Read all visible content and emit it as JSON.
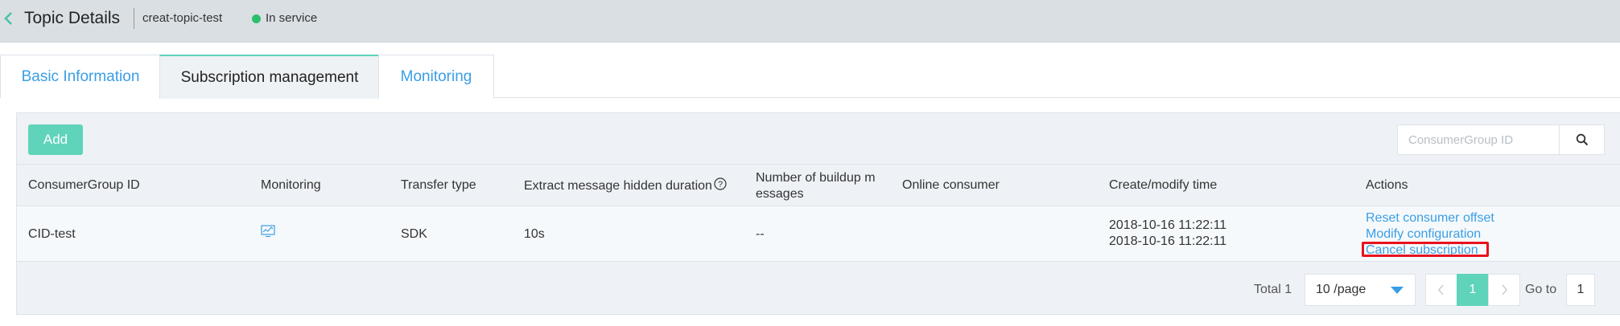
{
  "header": {
    "title": "Topic Details",
    "topic_name": "creat-topic-test",
    "status": "In service",
    "status_color": "#2cbf6e"
  },
  "tabs": [
    {
      "label": "Basic Information"
    },
    {
      "label": "Subscription management"
    },
    {
      "label": "Monitoring"
    }
  ],
  "toolbar": {
    "add_label": "Add",
    "search_placeholder": "ConsumerGroup ID"
  },
  "table": {
    "columns": {
      "group_id": "ConsumerGroup ID",
      "monitoring": "Monitoring",
      "transfer_type": "Transfer type",
      "hidden_duration": "Extract message hidden duration",
      "buildup_line1": "Number of buildup m",
      "buildup_line2": "essages",
      "online_consumer": "Online consumer",
      "time": "Create/modify time",
      "actions": "Actions"
    },
    "rows": [
      {
        "group_id": "CID-test",
        "monitoring_icon": "monitor-chart-icon",
        "transfer_type": "SDK",
        "hidden_duration": "10s",
        "buildup": "--",
        "online_consumer": "",
        "create_time": "2018-10-16 11:22:11",
        "modify_time": "2018-10-16 11:22:11",
        "actions": {
          "reset": "Reset consumer offset",
          "modify": "Modify configuration",
          "cancel": "Cancel subscription"
        }
      }
    ]
  },
  "pagination": {
    "total": "Total 1",
    "page_size": "10 /page",
    "current_page": "1",
    "goto_label": "Go to",
    "goto_value": "1"
  },
  "colors": {
    "accent": "#5fd4ba",
    "link": "#3a9ee6",
    "highlight": "#e8121c"
  }
}
